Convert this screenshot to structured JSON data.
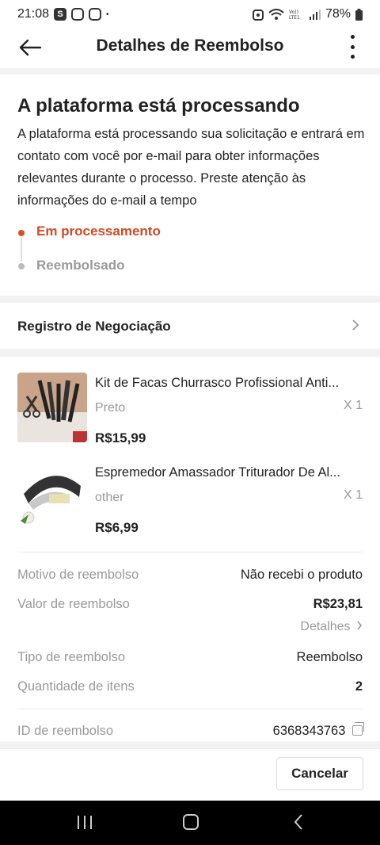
{
  "status_bar": {
    "time": "21:08",
    "notification_icons": [
      "S",
      "instagram-icon",
      "instagram-icon",
      "•"
    ],
    "battery": "78%"
  },
  "header": {
    "title": "Detalhes de Reembolso"
  },
  "status_card": {
    "heading": "A plataforma está processando",
    "description": "A plataforma está processando sua solicitação e entrará em contato com você por e-mail para obter informações relevantes durante o processo. Preste atenção às informações do e-mail a tempo",
    "steps": [
      {
        "label": "Em processamento",
        "active": true
      },
      {
        "label": "Reembolsado",
        "active": false
      }
    ]
  },
  "negotiation": {
    "label": "Registro de Negociação"
  },
  "products": [
    {
      "name": "Kit de Facas Churrasco Profissional Anti...",
      "variant": "Preto",
      "quantity": "X 1",
      "price": "R$15,99"
    },
    {
      "name": "Espremedor Amassador Triturador De Al...",
      "variant": "other",
      "quantity": "X 1",
      "price": "R$6,99"
    }
  ],
  "refund_info": {
    "reason_label": "Motivo de reembolso",
    "reason_value": "Não recebi o produto",
    "amount_label": "Valor de reembolso",
    "amount_value": "R$23,81",
    "details_link": "Detalhes",
    "type_label": "Tipo de reembolso",
    "type_value": "Reembolso",
    "qty_label": "Quantidade de itens",
    "qty_value": "2",
    "id_label": "ID de reembolso",
    "id_value": "6368343763"
  },
  "actions": {
    "cancel_label": "Cancelar"
  },
  "colors": {
    "accent": "#d14a25",
    "inactive": "#9a9a9a"
  }
}
